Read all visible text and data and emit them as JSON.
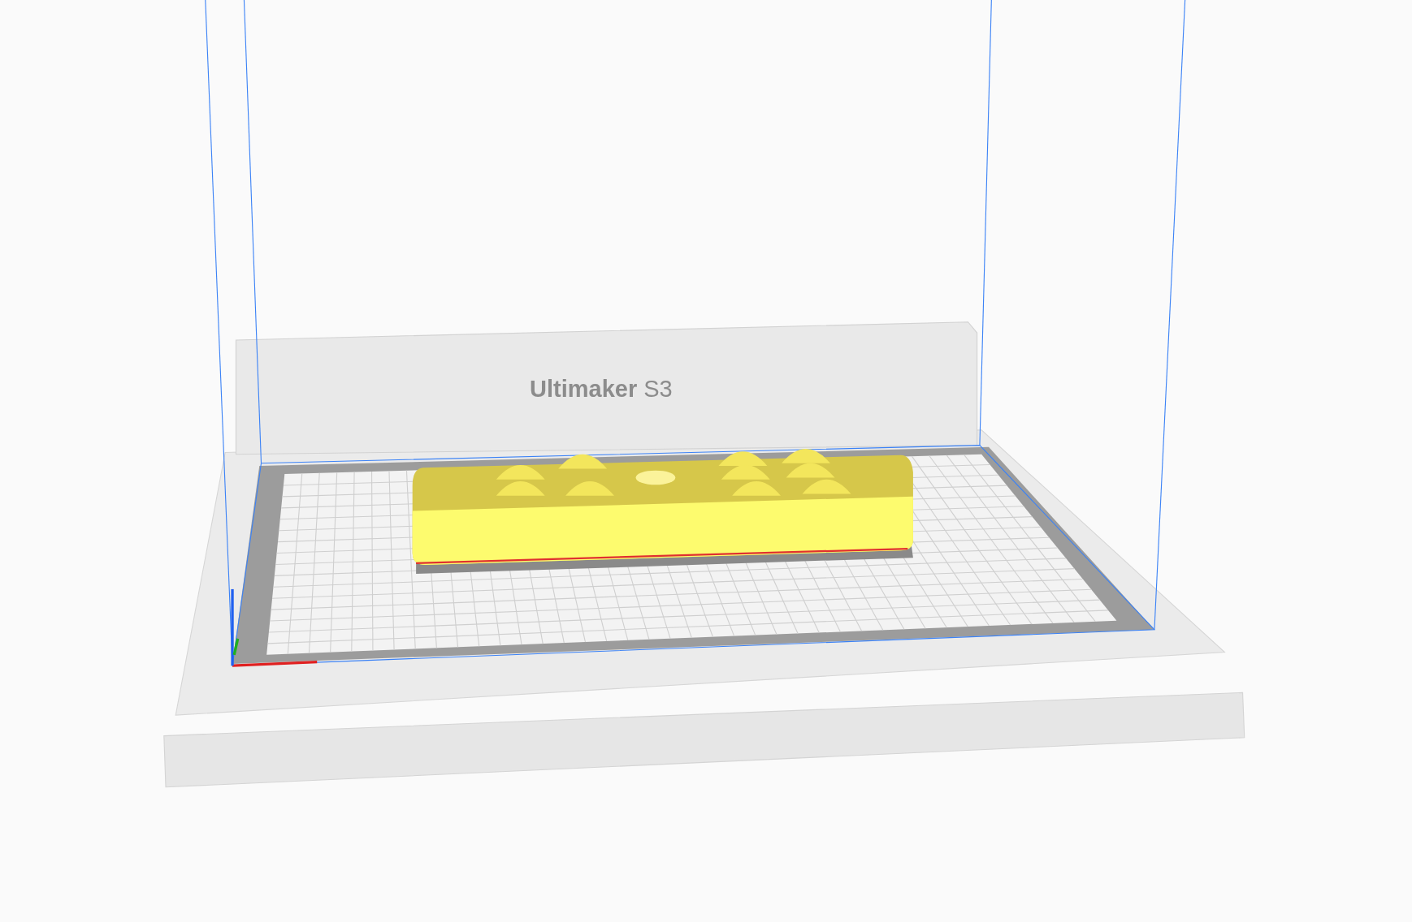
{
  "viewport": {
    "printer_label": "**Ultimaker** S3"
  }
}
